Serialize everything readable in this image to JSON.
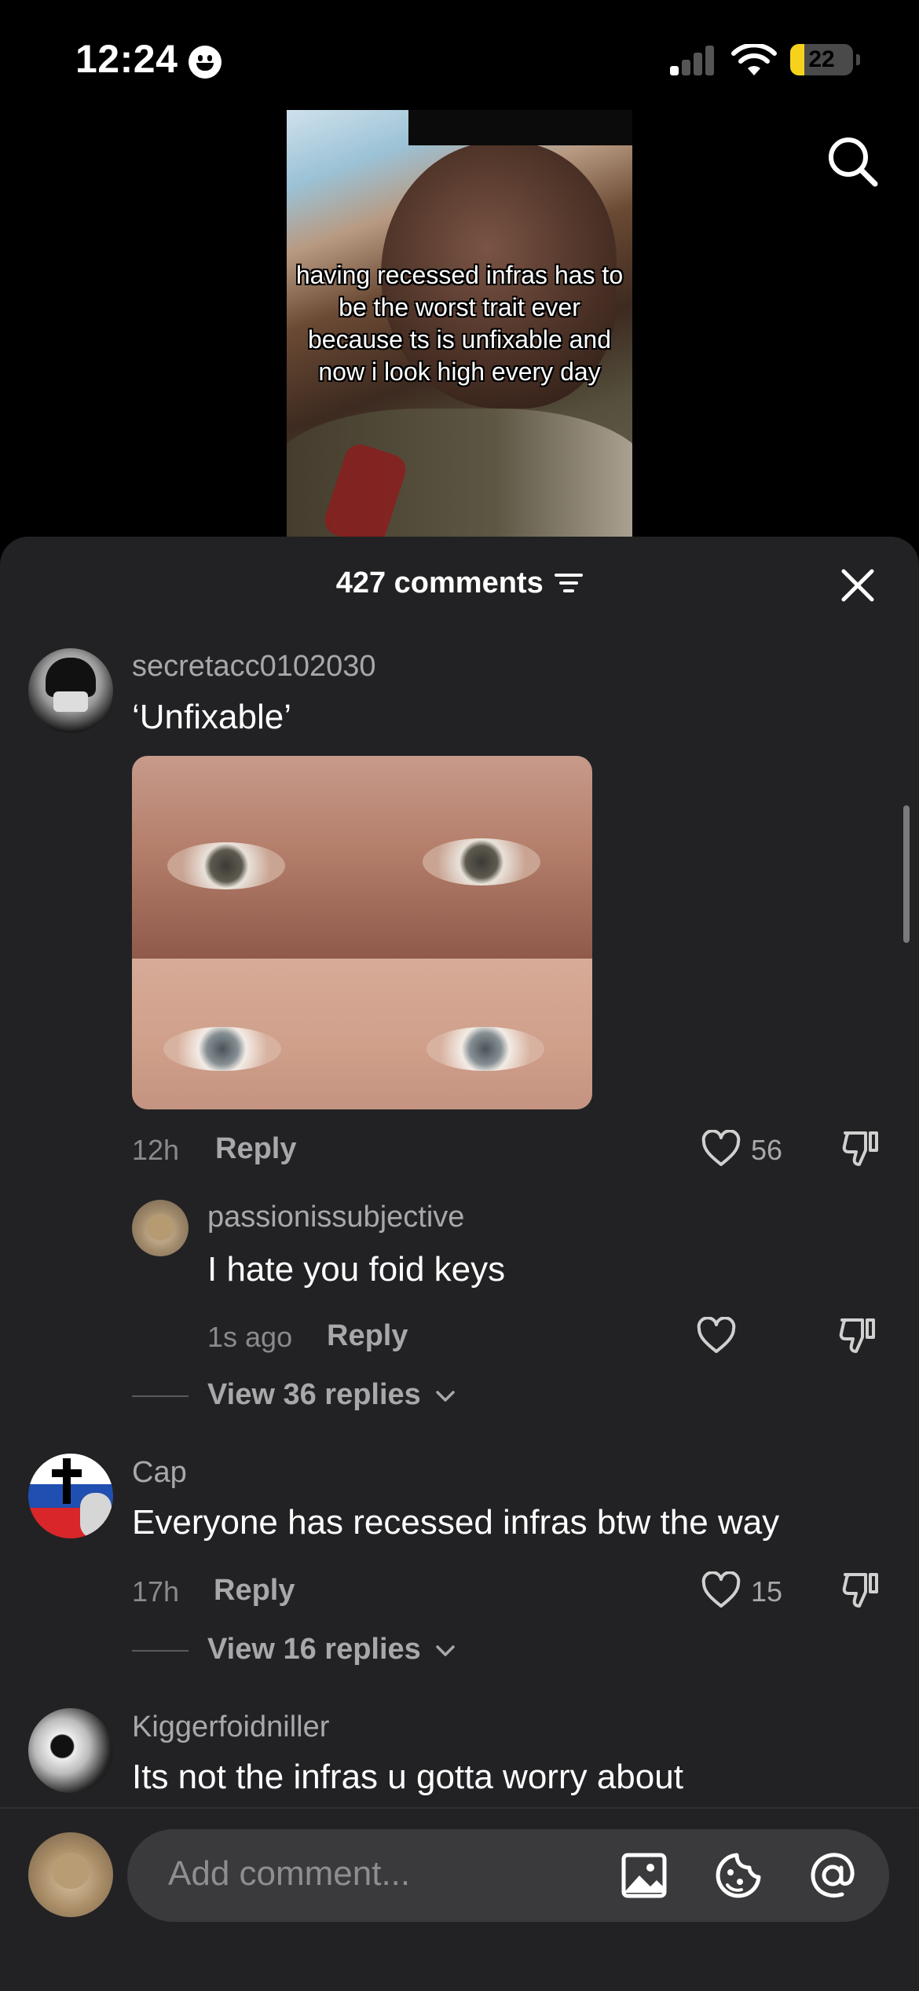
{
  "status_bar": {
    "time": "12:24",
    "battery_level": "22",
    "signal_icon": "signal-icon",
    "wifi_icon": "wifi-icon"
  },
  "video": {
    "caption": "having recessed infras has to be the worst trait ever because ts is unfixable and now i look high every day"
  },
  "comments_sheet": {
    "count_label": "427 comments",
    "filter_icon": "filter-icon",
    "close_icon": "close-icon"
  },
  "comments": [
    {
      "username": "secretacc0102030",
      "text": "‘Unfixable’",
      "time": "12h",
      "reply_label": "Reply",
      "likes": "56",
      "has_image": true,
      "reply": {
        "username": "passionissubjective",
        "text": "I hate you foid keys",
        "time": "1s ago",
        "reply_label": "Reply"
      },
      "view_replies": "View 36 replies"
    },
    {
      "username": "Cap",
      "text": "Everyone has recessed infras btw the way",
      "time": "17h",
      "reply_label": "Reply",
      "likes": "15",
      "view_replies": "View 16 replies"
    },
    {
      "username": "Kiggerfoidniller",
      "text": "Its not the infras u gotta worry about"
    }
  ],
  "composer": {
    "placeholder": "Add comment...",
    "icons": [
      "image-icon",
      "emoji-icon",
      "mention-icon"
    ]
  },
  "colors": {
    "sheet_bg": "#222224",
    "muted_text": "#a8a8aa",
    "battery_yellow": "#f7d21d"
  }
}
